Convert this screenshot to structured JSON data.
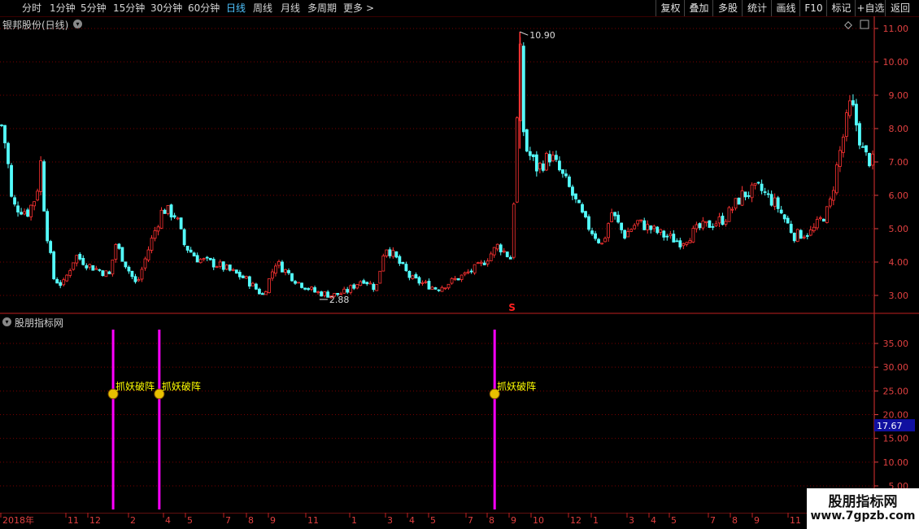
{
  "toolbar": {
    "periods": [
      "分时",
      "1分钟",
      "5分钟",
      "15分钟",
      "30分钟",
      "60分钟",
      "日线",
      "周线",
      "月线",
      "多周期",
      "更多"
    ],
    "active": "日线",
    "more_arrow": ">",
    "right_buttons": [
      "复权",
      "叠加",
      "多股",
      "统计",
      "画线",
      "F10",
      "标记",
      "+自选",
      "返回"
    ]
  },
  "main_panel": {
    "title": "银邦股份(日线)",
    "high_label": "10.90",
    "low_label": "2.88",
    "signal_marker": "S",
    "y_ticks": [
      "11.00",
      "10.00",
      "9.00",
      "8.00",
      "7.00",
      "6.00",
      "5.00",
      "4.00",
      "3.00"
    ]
  },
  "sub_panel": {
    "title": "股朋指标网",
    "signal_text": "抓妖破阵",
    "y_ticks": [
      "35.00",
      "30.00",
      "25.00",
      "20.00",
      "15.00",
      "10.00",
      "5.00"
    ],
    "current_value": "17.67"
  },
  "x_axis": {
    "labels": [
      "2018年",
      "11",
      "12",
      "2",
      "4",
      "5",
      "7",
      "8",
      "9",
      "11",
      "1",
      "3",
      "4",
      "5",
      "7",
      "8",
      "9",
      "10",
      "12",
      "1",
      "3",
      "4",
      "5",
      "7",
      "8",
      "9",
      "11"
    ]
  },
  "watermark": {
    "title": "股朋指标网",
    "url": "www.7gpzb.com"
  },
  "colors": {
    "up": "#ff3232",
    "down": "#54ffff",
    "signal": "#ff00ff",
    "grid": "#7a0000",
    "label": "#ffff00"
  },
  "chart_data": {
    "type": "candlestick",
    "title": "银邦股份(日线)",
    "ylim": [
      2.6,
      11.3
    ],
    "high": 10.9,
    "low": 2.88,
    "close_path": [
      {
        "t": 0,
        "v": 8.1
      },
      {
        "t": 0.006,
        "v": 7.3
      },
      {
        "t": 0.012,
        "v": 5.7
      },
      {
        "t": 0.03,
        "v": 5.5
      },
      {
        "t": 0.04,
        "v": 6.0
      },
      {
        "t": 0.045,
        "v": 7.0
      },
      {
        "t": 0.05,
        "v": 5.2
      },
      {
        "t": 0.06,
        "v": 3.5
      },
      {
        "t": 0.07,
        "v": 3.3
      },
      {
        "t": 0.085,
        "v": 4.2
      },
      {
        "t": 0.1,
        "v": 3.9
      },
      {
        "t": 0.125,
        "v": 3.6
      },
      {
        "t": 0.13,
        "v": 4.6
      },
      {
        "t": 0.145,
        "v": 3.8
      },
      {
        "t": 0.155,
        "v": 3.3
      },
      {
        "t": 0.17,
        "v": 4.5
      },
      {
        "t": 0.185,
        "v": 5.6
      },
      {
        "t": 0.2,
        "v": 5.4
      },
      {
        "t": 0.21,
        "v": 4.5
      },
      {
        "t": 0.225,
        "v": 4.1
      },
      {
        "t": 0.25,
        "v": 3.9
      },
      {
        "t": 0.28,
        "v": 3.5
      },
      {
        "t": 0.3,
        "v": 3.0
      },
      {
        "t": 0.315,
        "v": 4.0
      },
      {
        "t": 0.34,
        "v": 3.4
      },
      {
        "t": 0.36,
        "v": 3.1
      },
      {
        "t": 0.38,
        "v": 3.0
      },
      {
        "t": 0.395,
        "v": 3.1
      },
      {
        "t": 0.415,
        "v": 3.5
      },
      {
        "t": 0.43,
        "v": 3.2
      },
      {
        "t": 0.44,
        "v": 4.5
      },
      {
        "t": 0.45,
        "v": 4.2
      },
      {
        "t": 0.47,
        "v": 3.5
      },
      {
        "t": 0.5,
        "v": 3.2
      },
      {
        "t": 0.53,
        "v": 3.6
      },
      {
        "t": 0.55,
        "v": 3.9
      },
      {
        "t": 0.57,
        "v": 4.5
      },
      {
        "t": 0.585,
        "v": 4.1
      },
      {
        "t": 0.59,
        "v": 7.0
      },
      {
        "t": 0.595,
        "v": 10.5
      },
      {
        "t": 0.6,
        "v": 7.5
      },
      {
        "t": 0.615,
        "v": 6.8
      },
      {
        "t": 0.63,
        "v": 7.2
      },
      {
        "t": 0.65,
        "v": 6.3
      },
      {
        "t": 0.67,
        "v": 5.2
      },
      {
        "t": 0.69,
        "v": 4.5
      },
      {
        "t": 0.7,
        "v": 5.5
      },
      {
        "t": 0.715,
        "v": 4.8
      },
      {
        "t": 0.73,
        "v": 5.2
      },
      {
        "t": 0.76,
        "v": 4.8
      },
      {
        "t": 0.78,
        "v": 4.6
      },
      {
        "t": 0.8,
        "v": 5.0
      },
      {
        "t": 0.83,
        "v": 5.3
      },
      {
        "t": 0.85,
        "v": 6.0
      },
      {
        "t": 0.87,
        "v": 6.2
      },
      {
        "t": 0.89,
        "v": 5.7
      },
      {
        "t": 0.91,
        "v": 4.8
      },
      {
        "t": 0.93,
        "v": 4.9
      },
      {
        "t": 0.95,
        "v": 5.6
      },
      {
        "t": 0.96,
        "v": 7.0
      },
      {
        "t": 0.975,
        "v": 8.8
      },
      {
        "t": 0.99,
        "v": 7.2
      },
      {
        "t": 1.0,
        "v": 7.0
      }
    ],
    "signals": [
      {
        "t": 0.128,
        "value": 30
      },
      {
        "t": 0.181,
        "value": 30
      },
      {
        "t": 0.566,
        "value": 30
      }
    ],
    "indicator_ylim": [
      0,
      40
    ],
    "indicator_current": 17.67
  }
}
